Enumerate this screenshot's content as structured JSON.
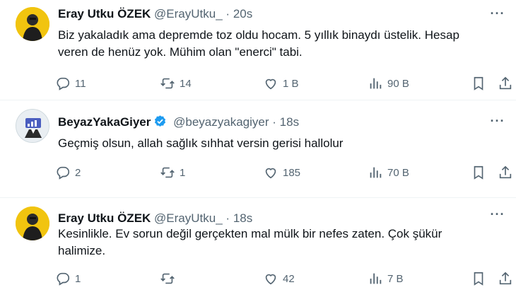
{
  "tweets": [
    {
      "name": "Eray Utku ÖZEK",
      "handle": "@ErayUtku_",
      "dot": "·",
      "time": "20s",
      "text_lines": [
        "Biz yakaladık ama depremde toz oldu hocam. 5 yıllık binaydı üstelik. Hesap",
        "veren de henüz yok. Mühim olan \"enerci\" tabi."
      ],
      "replies": "11",
      "retweets": "14",
      "likes": "1 B",
      "views": "90 B",
      "verified": false
    },
    {
      "name": "BeyazYakaGiyer",
      "handle": "@beyazyakagiyer",
      "dot": "·",
      "time": "18s",
      "text_lines": [
        "Geçmiş olsun, allah sağlık sıhhat versin gerisi hallolur"
      ],
      "replies": "2",
      "retweets": "1",
      "likes": "185",
      "views": "70 B",
      "verified": true
    },
    {
      "name": "Eray Utku ÖZEK",
      "handle": "@ErayUtku_",
      "dot": "·",
      "time": "18s",
      "text_lines": [
        "Kesinlikle. Ev sorun değil gerçekten mal mülk bir nefes zaten. Çok şükür",
        "halimize."
      ],
      "replies": "1",
      "retweets": "",
      "likes": "42",
      "views": "7 B",
      "verified": false
    }
  ],
  "colors": {
    "text": "#0f1419",
    "muted": "#536471",
    "verified": "#1d9bf0",
    "avatar_bg": "#f1c40f"
  },
  "icons": [
    "reply-icon",
    "retweet-icon",
    "like-icon",
    "views-icon",
    "bookmark-icon",
    "share-icon",
    "more-icon",
    "verified-icon"
  ]
}
